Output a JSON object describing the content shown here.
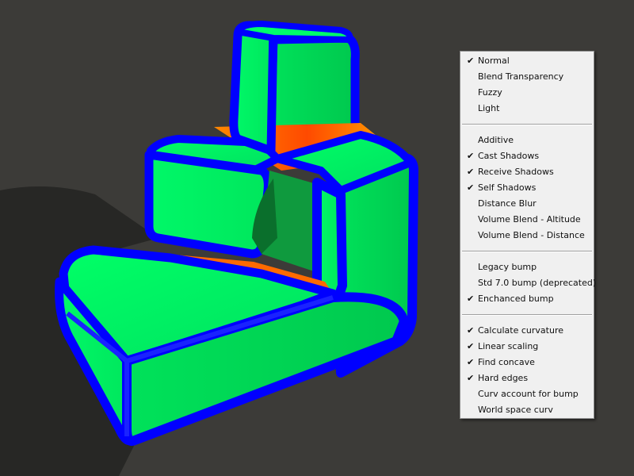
{
  "viewport": {
    "background": "#3c3b38",
    "object_colors": {
      "surface": "#00f060",
      "edge": "#0000ff",
      "crease": "#ff5000",
      "shadow": "#262624"
    }
  },
  "menu": {
    "groups": [
      {
        "items": [
          {
            "label": "Normal",
            "checked": true
          },
          {
            "label": "Blend Transparency",
            "checked": false
          },
          {
            "label": "Fuzzy",
            "checked": false
          },
          {
            "label": "Light",
            "checked": false
          }
        ]
      },
      {
        "items": [
          {
            "label": "Additive",
            "checked": false
          },
          {
            "label": "Cast Shadows",
            "checked": true
          },
          {
            "label": "Receive Shadows",
            "checked": true
          },
          {
            "label": "Self Shadows",
            "checked": true
          },
          {
            "label": "Distance Blur",
            "checked": false
          },
          {
            "label": "Volume Blend - Altitude",
            "checked": false
          },
          {
            "label": "Volume Blend - Distance",
            "checked": false
          }
        ]
      },
      {
        "items": [
          {
            "label": "Legacy bump",
            "checked": false
          },
          {
            "label": "Std 7.0 bump (deprecated)",
            "checked": false
          },
          {
            "label": "Enchanced bump",
            "checked": true
          }
        ]
      },
      {
        "items": [
          {
            "label": "Calculate curvature",
            "checked": true
          },
          {
            "label": "Linear scaling",
            "checked": true
          },
          {
            "label": "Find concave",
            "checked": true
          },
          {
            "label": "Hard edges",
            "checked": true
          },
          {
            "label": "Curv account for bump",
            "checked": false
          },
          {
            "label": "World space curv",
            "checked": false
          }
        ]
      }
    ],
    "check_glyph": "✔"
  }
}
